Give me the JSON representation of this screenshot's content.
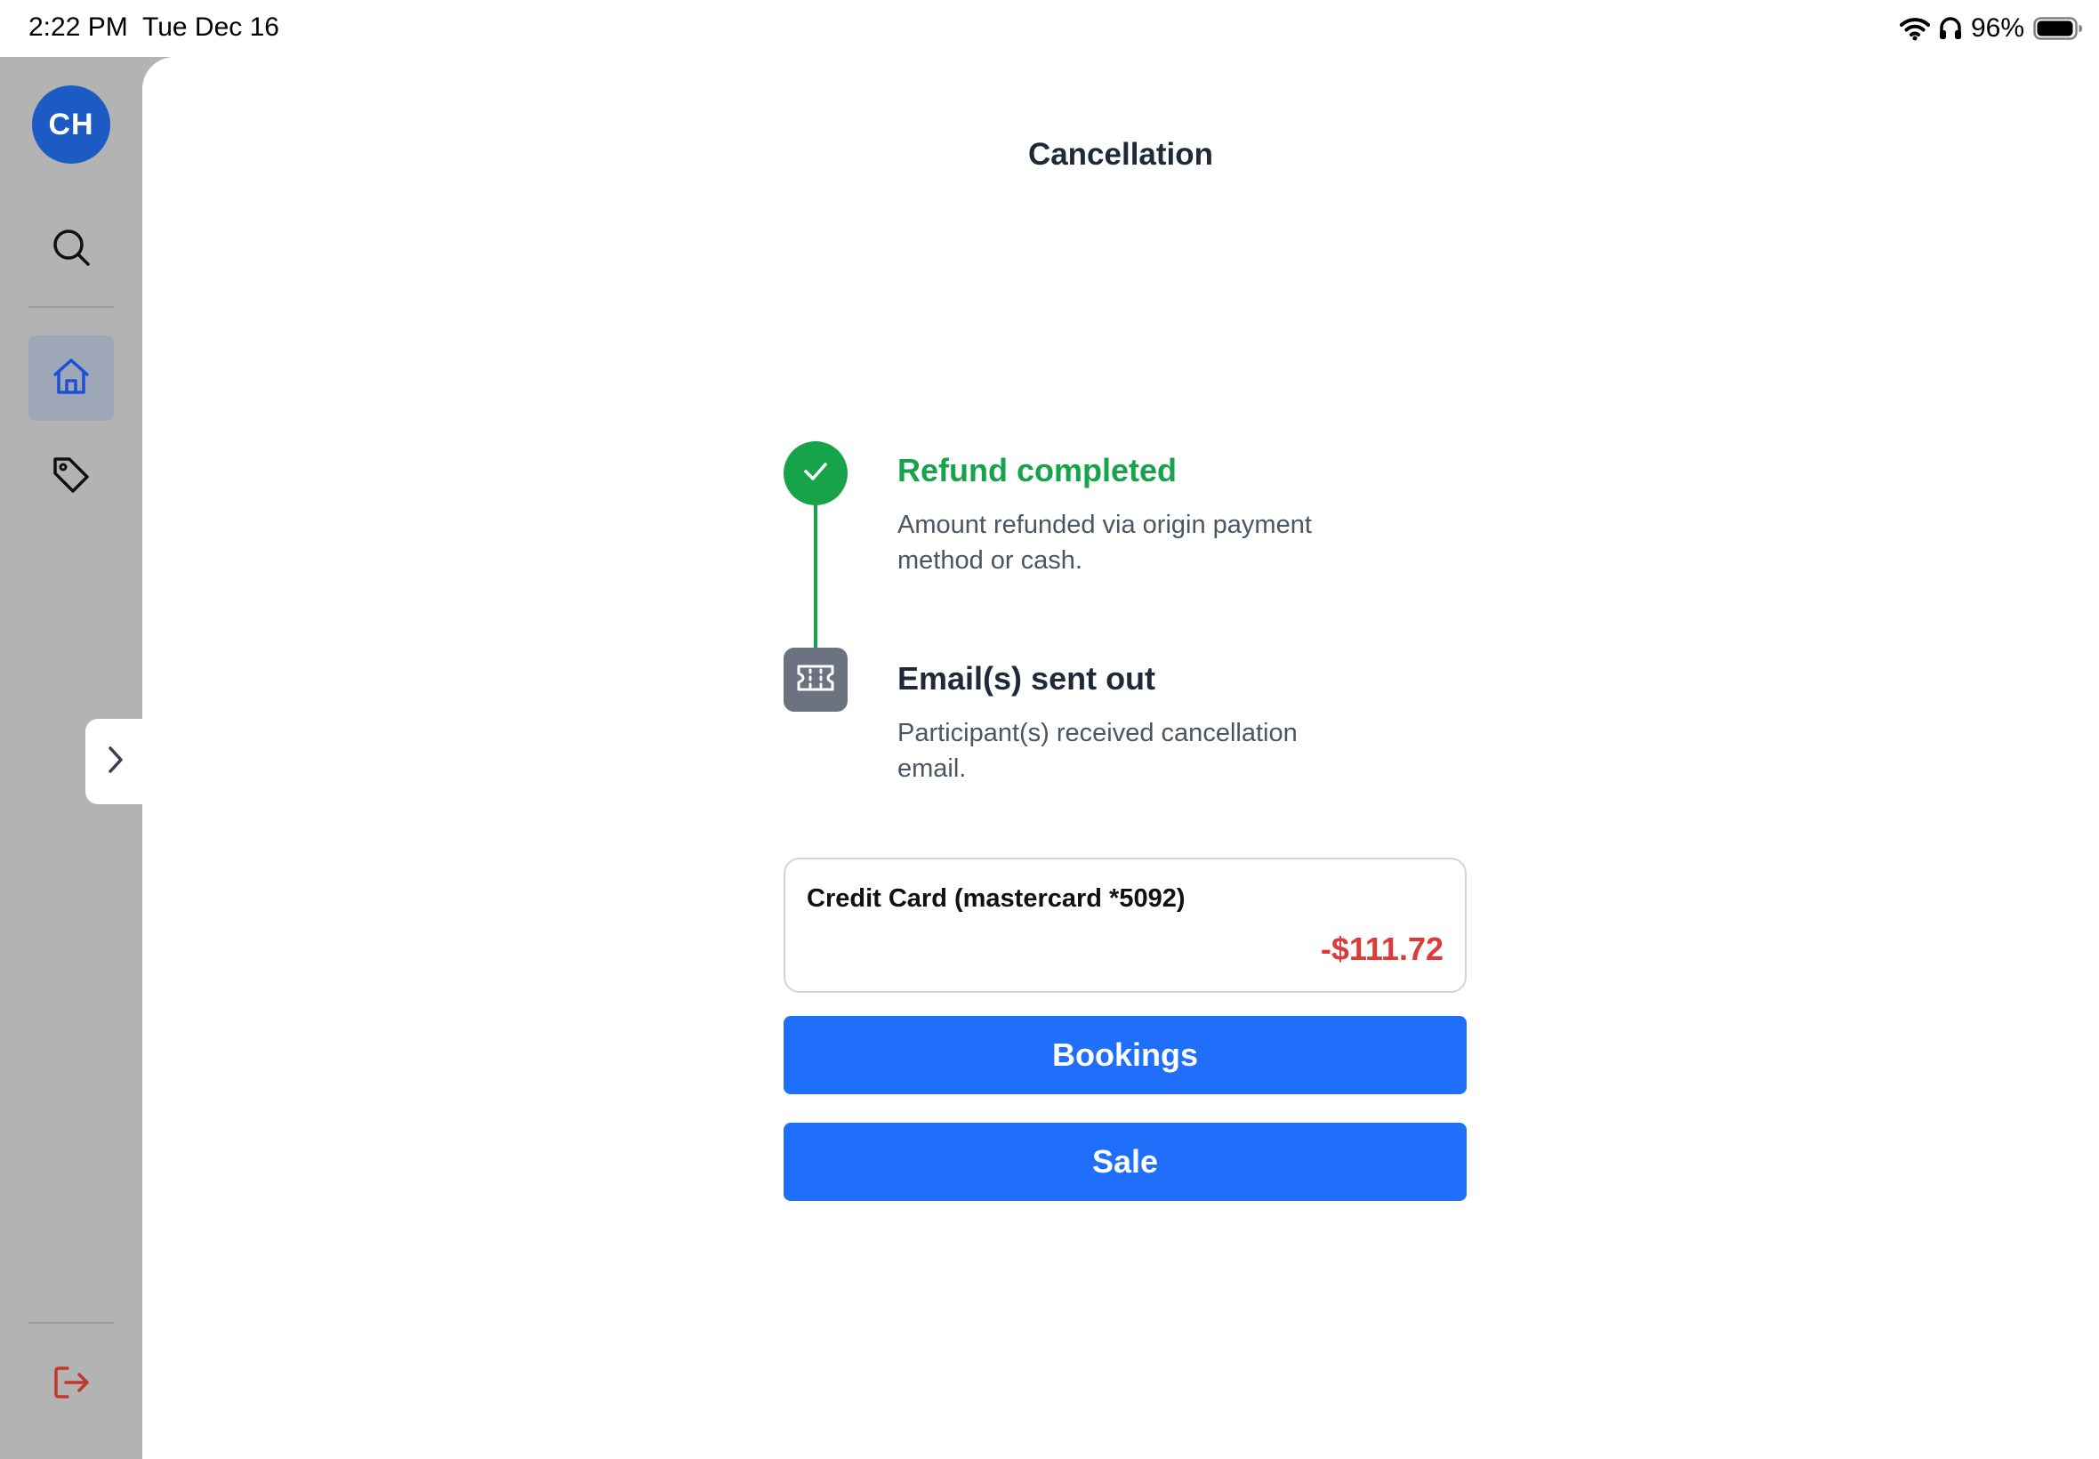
{
  "status_bar": {
    "time": "2:22 PM",
    "date": "Tue Dec 16",
    "battery_percent": "96%",
    "icons": [
      "wifi-icon",
      "headphones-icon",
      "battery-icon"
    ]
  },
  "sidebar": {
    "avatar_initials": "CH",
    "items": [
      {
        "icon": "search-icon",
        "active": false
      },
      {
        "icon": "home-icon",
        "active": true
      },
      {
        "icon": "tag-icon",
        "active": false
      },
      {
        "icon": "logout-icon",
        "active": false
      }
    ],
    "expand_icon": "chevron-right-icon"
  },
  "page": {
    "title": "Cancellation"
  },
  "steps": [
    {
      "title": "Refund completed",
      "description": "Amount refunded via origin payment method or cash.",
      "icon": "check-icon",
      "status": "done"
    },
    {
      "title": "Email(s) sent out",
      "description": "Participant(s) received cancellation email.",
      "icon": "ticket-icon",
      "status": "pending"
    }
  ],
  "payment": {
    "method": "Credit Card (mastercard *5092)",
    "amount": "-$111.72"
  },
  "actions": {
    "bookings_label": "Bookings",
    "sale_label": "Sale"
  },
  "colors": {
    "accent": "#1f6ffb",
    "success": "#16a34a",
    "danger": "#dc3b3b",
    "avatar": "#1d5bc4",
    "sidebar_bg": "#b3b3b3",
    "logout": "#c0392b"
  }
}
